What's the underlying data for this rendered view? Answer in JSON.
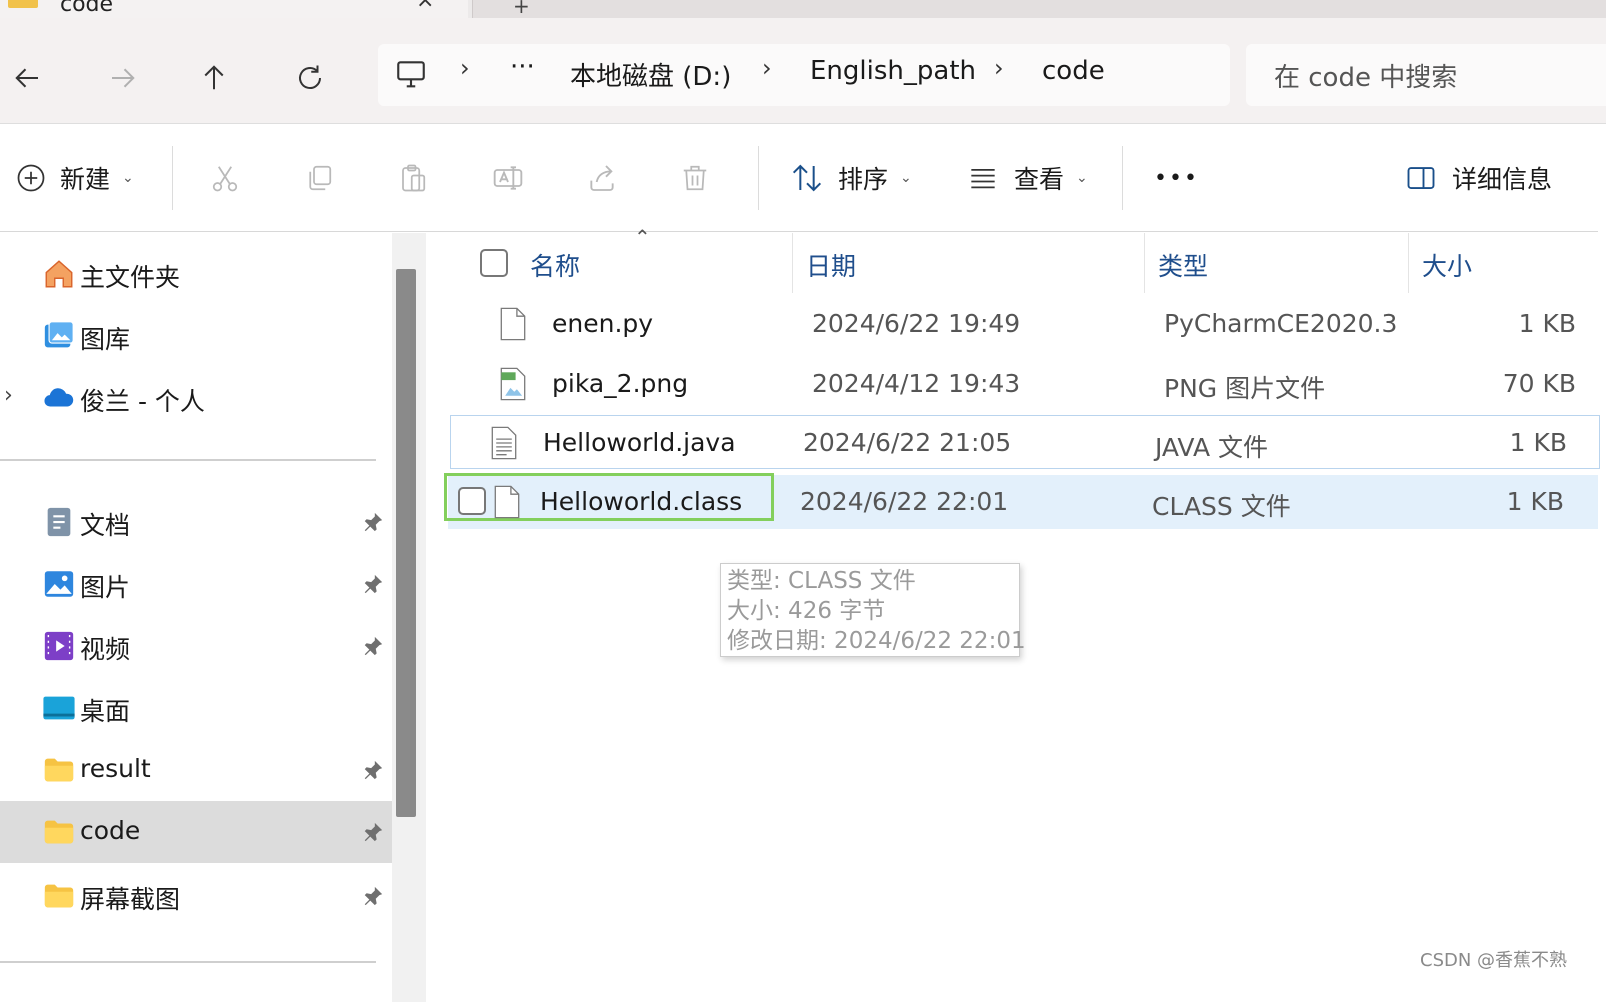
{
  "tab": {
    "title": "code",
    "close": "×",
    "new_tab": "+"
  },
  "address": {
    "crumbs": [
      "本地磁盘 (D:)",
      "English_path",
      "code"
    ],
    "ellipsis": "···",
    "separator": "›"
  },
  "search": {
    "placeholder": "在 code 中搜索"
  },
  "commandbar": {
    "new_label": "新建",
    "sort_label": "排序",
    "view_label": "查看",
    "more_label": "•••",
    "details_label": "详细信息"
  },
  "sidebar": {
    "quick": [
      {
        "label": "主文件夹",
        "icon": "home-icon"
      },
      {
        "label": "图库",
        "icon": "gallery-icon"
      },
      {
        "label": "俊兰 - 个人",
        "icon": "onedrive-icon"
      }
    ],
    "pinned": [
      {
        "label": "文档",
        "icon": "documents-icon"
      },
      {
        "label": "图片",
        "icon": "pictures-icon"
      },
      {
        "label": "视频",
        "icon": "videos-icon"
      },
      {
        "label": "桌面",
        "icon": "desktop-icon"
      },
      {
        "label": "result",
        "icon": "folder-icon"
      },
      {
        "label": "code",
        "icon": "folder-icon"
      },
      {
        "label": "屏幕截图",
        "icon": "folder-icon"
      }
    ],
    "selected": "code"
  },
  "columns": {
    "name": "名称",
    "date": "日期",
    "type": "类型",
    "size": "大小"
  },
  "files": [
    {
      "name": "enen.py",
      "date": "2024/6/22 19:49",
      "type": "PyCharmCE2020.3",
      "size": "1 KB"
    },
    {
      "name": "pika_2.png",
      "date": "2024/4/12 19:43",
      "type": "PNG 图片文件",
      "size": "70 KB"
    },
    {
      "name": "Helloworld.java",
      "date": "2024/6/22 21:05",
      "type": "JAVA 文件",
      "size": "1 KB"
    },
    {
      "name": "Helloworld.class",
      "date": "2024/6/22 22:01",
      "type": "CLASS 文件",
      "size": "1 KB"
    }
  ],
  "tooltip": {
    "line1": "类型: CLASS 文件",
    "line2": "大小: 426 字节",
    "line3": "修改日期: 2024/6/22 22:01"
  },
  "watermark": "CSDN @香蕉不熟",
  "colors": {
    "accent": "#0067c0",
    "selection": "#e3f0fb",
    "rename_border": "#83cf5c",
    "folder": "#f1c24b"
  }
}
